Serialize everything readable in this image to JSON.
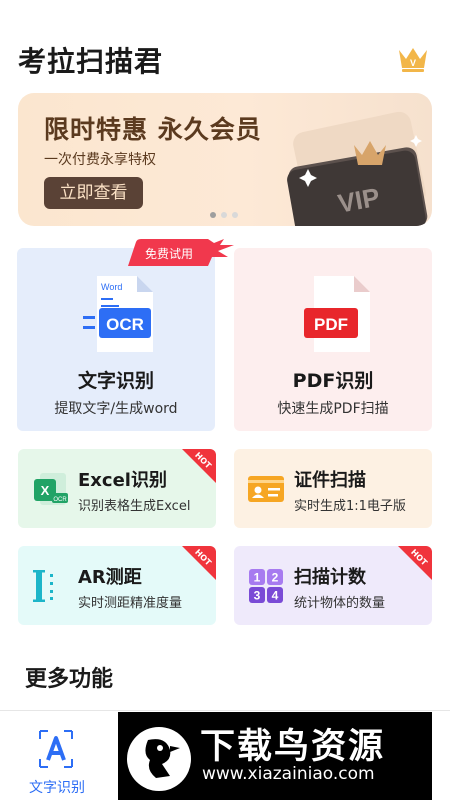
{
  "header": {
    "app_title": "考拉扫描君",
    "vip_icon": "crown-icon"
  },
  "banner": {
    "title": "限时特惠 永久会员",
    "subtitle": "一次付费永享特权",
    "button_label": "立即查看",
    "card_text": "VIP",
    "carousel_count": 3,
    "carousel_active": 1
  },
  "features": {
    "text_recognition": {
      "title": "文字识别",
      "desc": "提取文字/生成word",
      "badge": "免费试用",
      "doc_label": "Word",
      "icon_label": "OCR"
    },
    "pdf_recognition": {
      "title": "PDF识别",
      "desc": "快速生成PDF扫描",
      "icon_label": "PDF"
    },
    "excel": {
      "title": "Excel识别",
      "desc": "识别表格生成Excel",
      "hot": "HOT",
      "icon_label": "OCR"
    },
    "id_scan": {
      "title": "证件扫描",
      "desc": "实时生成1:1电子版"
    },
    "ar_measure": {
      "title": "AR测距",
      "desc": "实时测距精准度量",
      "hot": "HOT"
    },
    "scan_count": {
      "title": "扫描计数",
      "desc": "统计物体的数量",
      "hot": "HOT",
      "digits": [
        "1",
        "2",
        "3",
        "4"
      ]
    }
  },
  "more_section": {
    "title": "更多功能"
  },
  "bottom_nav": {
    "active_tab_label": "文字识别"
  },
  "watermark": {
    "title": "下载鸟资源",
    "url": "www.xiazainiao.com"
  },
  "colors": {
    "accent": "#2d6ef5",
    "pdf_red": "#e8262b",
    "excel_green": "#21a366",
    "hot_red": "#f0343c",
    "banner_brown": "#5b3a1f"
  }
}
